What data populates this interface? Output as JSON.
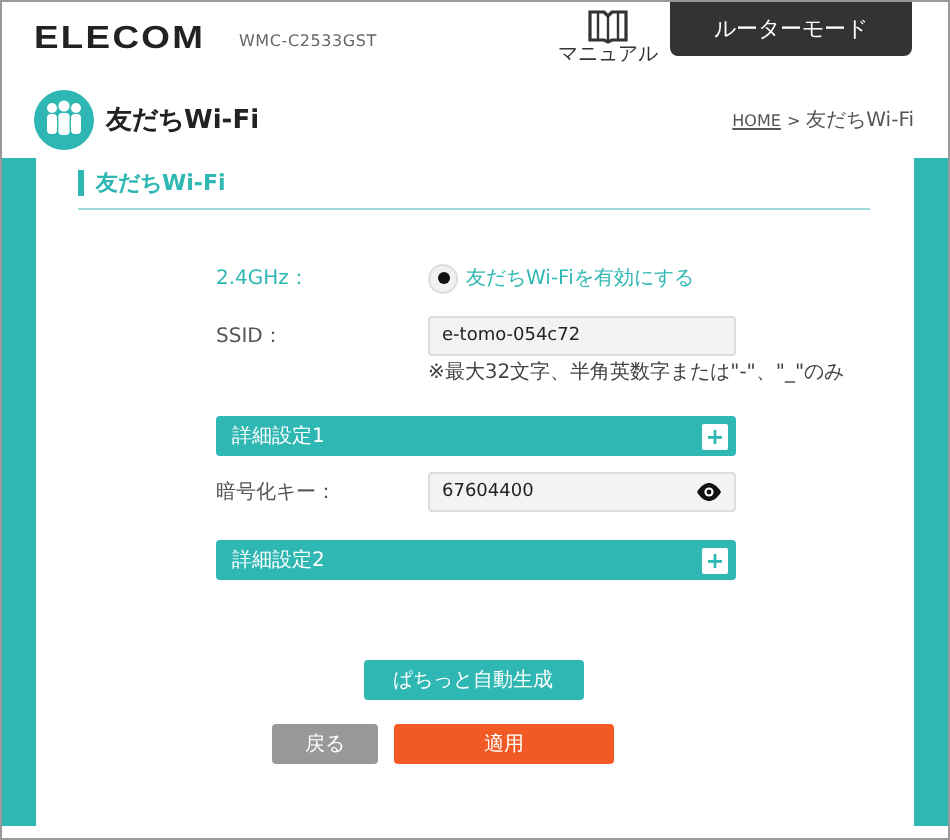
{
  "header": {
    "logo": "ELECOM",
    "model": "WMC-C2533GST",
    "manual_label": "マニュアル",
    "mode_tab": "ルーターモード"
  },
  "page": {
    "title": "友だちWi-Fi",
    "breadcrumb": [
      {
        "label": "HOME",
        "kind": "link"
      },
      {
        "label": ">",
        "kind": "separator"
      },
      {
        "label": "友だちWi-Fi",
        "kind": "current"
      }
    ]
  },
  "card": {
    "heading": "友だちWi-Fi",
    "rows": [
      {
        "kind": "radio",
        "label": "2.4GHz：",
        "option": "友だちWi-Fiを有効にする",
        "selected": true
      },
      {
        "kind": "text",
        "label": "SSID：",
        "value": "e-tomo-054c72",
        "note": "※最大32文字、半角英数字または\"-\"、\"_\"のみ"
      },
      {
        "kind": "section",
        "label": "詳細設定1",
        "expanded": false
      },
      {
        "kind": "password",
        "label": "暗号化キー：",
        "value": "67604400"
      },
      {
        "kind": "section",
        "label": "詳細設定2",
        "expanded": false
      }
    ],
    "generate_button": "ぱちっと自動生成",
    "back_button": "戻る",
    "apply_button": "適用"
  }
}
